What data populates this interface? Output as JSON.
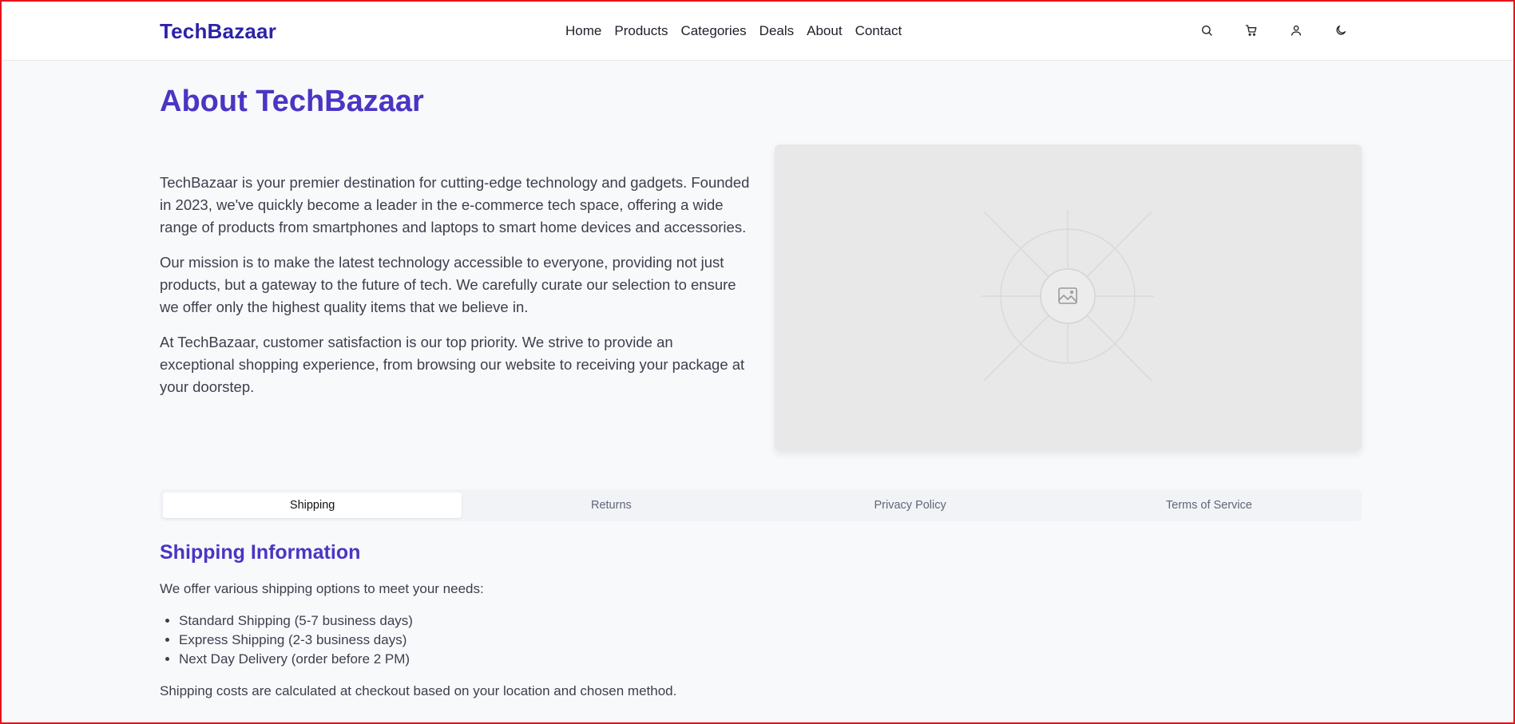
{
  "header": {
    "brand": "TechBazaar",
    "nav": [
      "Home",
      "Products",
      "Categories",
      "Deals",
      "About",
      "Contact"
    ],
    "icons": [
      "search-icon",
      "cart-icon",
      "user-icon",
      "moon-icon"
    ]
  },
  "page": {
    "title": "About TechBazaar",
    "paragraphs": [
      "TechBazaar is your premier destination for cutting-edge technology and gadgets. Founded in 2023, we've quickly become a leader in the e-commerce tech space, offering a wide range of products from smartphones and laptops to smart home devices and accessories.",
      "Our mission is to make the latest technology accessible to everyone, providing not just products, but a gateway to the future of tech. We carefully curate our selection to ensure we offer only the highest quality items that we believe in.",
      "At TechBazaar, customer satisfaction is our top priority. We strive to provide an exceptional shopping experience, from browsing our website to receiving your package at your doorstep."
    ],
    "image_icon": "image-placeholder-icon"
  },
  "tabs": {
    "items": [
      "Shipping",
      "Returns",
      "Privacy Policy",
      "Terms of Service"
    ],
    "active": "Shipping"
  },
  "shipping": {
    "title": "Shipping Information",
    "intro": "We offer various shipping options to meet your needs:",
    "options": [
      "Standard Shipping (5-7 business days)",
      "Express Shipping (2-3 business days)",
      "Next Day Delivery (order before 2 PM)"
    ],
    "outro": "Shipping costs are calculated at checkout based on your location and chosen method."
  },
  "colors": {
    "brand": "#2c23a8",
    "accent": "#4a35c4",
    "frame": "#e8121b"
  }
}
